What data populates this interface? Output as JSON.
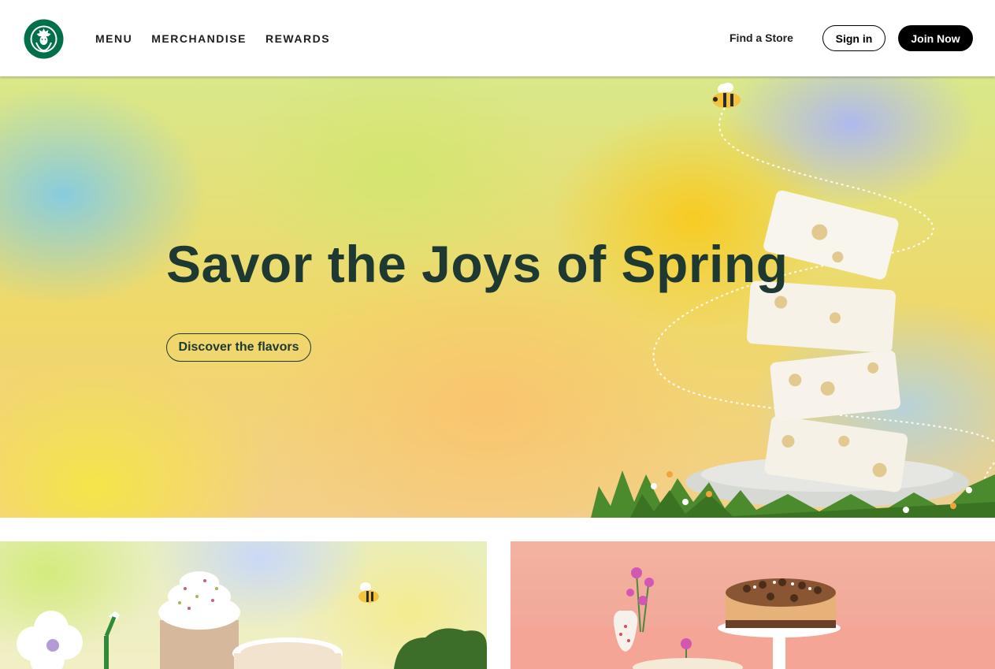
{
  "header": {
    "logo_alt": "Starbucks",
    "nav": [
      {
        "label": "MENU"
      },
      {
        "label": "MERCHANDISE"
      },
      {
        "label": "REWARDS"
      }
    ],
    "find_store_label": "Find a Store",
    "sign_in_label": "Sign in",
    "join_now_label": "Join Now"
  },
  "hero": {
    "title": "Savor the Joys of Spring",
    "cta_label": "Discover the flavors",
    "image": "nougat-stack-with-bee"
  },
  "promos": [
    {
      "image": "spring-drinks-with-flowers"
    },
    {
      "image": "cheesecake-on-stand"
    }
  ],
  "colors": {
    "brand_green": "#006241",
    "house_green": "#1e3932",
    "black": "#000000"
  }
}
